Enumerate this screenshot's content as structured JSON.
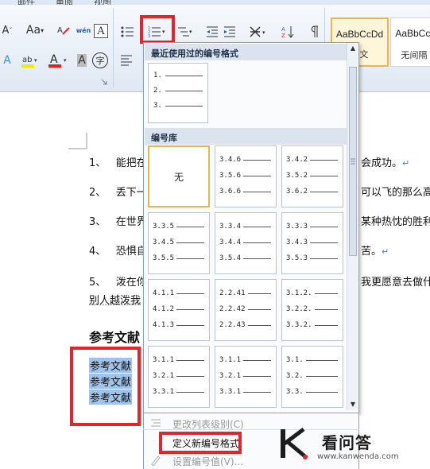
{
  "ribbon": {
    "tabs": [
      "邮件",
      "审阅",
      "视图"
    ],
    "font_case_label": "Aa",
    "wen_label": "wén",
    "a_char": "A",
    "bullet_button_icon": "numbered-list-icon",
    "style_normal_sample": "AaBbCcDd",
    "style_normal_name": "正文",
    "style_nospacing_sample": "AaBbCcI",
    "style_nospacing_name": "无间隔",
    "char_circle": "字"
  },
  "dropdown": {
    "recent_header": "最近使用过的编号格式",
    "recent_formats": [
      [
        "1.",
        "2.",
        "3."
      ]
    ],
    "library_header": "编号库",
    "none_label": "无",
    "library": [
      [
        "3.4.6",
        "3.5.6",
        "3.6.6"
      ],
      [
        "3.4.2",
        "3.5.2",
        "3.6.2"
      ],
      [
        "3.3.5",
        "3.4.5",
        "3.5.5"
      ],
      [
        "3.3.4",
        "3.4.4",
        "3.5.4"
      ],
      [
        "3.3.3",
        "3.4.3",
        "3.5.3"
      ],
      [
        "4.1.1",
        "4.1.2",
        "4.1.3"
      ],
      [
        "2.2.41",
        "2.2.42",
        "2.2.43"
      ],
      [
        "3.1.2.",
        "3.2.2.",
        "3.3.2."
      ],
      [
        "3.1.1",
        "3.2.1",
        "3.3.1"
      ],
      [
        "3.1.1",
        "3.2.1",
        "3.3.1"
      ],
      [
        "3.1.",
        "3.2.",
        "3.3."
      ]
    ]
  },
  "menu": {
    "change_level": "更改列表级别(C)",
    "define_new": "定义新编号格式",
    "set_value": "设置编号值(V)..."
  },
  "document": {
    "items": [
      {
        "num": "1、",
        "left": "能把在",
        "right": "会成功。"
      },
      {
        "num": "2、",
        "left": "丢下一",
        "right": "可以飞的那么高"
      },
      {
        "num": "3、",
        "left": "在世界",
        "right": "某种热忱的胜利"
      },
      {
        "num": "4、",
        "left": "恐惧自",
        "right": "苦。"
      },
      {
        "num": "5、",
        "left": "泼在你",
        "right": "我更愿意去做什"
      }
    ],
    "item5_continuation": "别人越泼我",
    "heading": "参考文献",
    "references": [
      "参考文献",
      "参考文献",
      "参考文献"
    ],
    "return_mark": "↵"
  },
  "watermark": {
    "title": "看问答",
    "url": "www.kanwenda.com"
  },
  "colors": {
    "highlight_red": "#e0262d",
    "selection_blue": "#9fc3ea",
    "ribbon_bg": "#dfe8f3"
  }
}
